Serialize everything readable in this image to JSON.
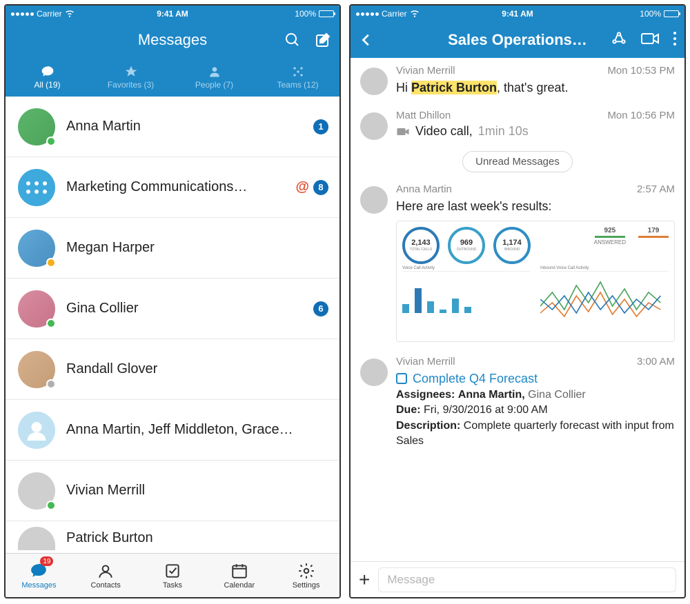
{
  "status": {
    "carrier": "Carrier",
    "time": "9:41 AM",
    "battery": "100%"
  },
  "left": {
    "title": "Messages",
    "tabs": [
      {
        "label": "All (19)"
      },
      {
        "label": "Favorites (3)"
      },
      {
        "label": "People (7)"
      },
      {
        "label": "Teams (12)"
      }
    ],
    "rows": [
      {
        "name": "Anna Martin",
        "badge": "1"
      },
      {
        "name": "Marketing Communications…",
        "mention": "@",
        "badge": "8"
      },
      {
        "name": "Megan Harper"
      },
      {
        "name": "Gina Collier",
        "badge": "6"
      },
      {
        "name": "Randall Glover"
      },
      {
        "name": "Anna Martin, Jeff Middleton, Grace…"
      },
      {
        "name": "Vivian Merrill"
      },
      {
        "name": "Patrick Burton"
      }
    ],
    "nav": [
      {
        "label": "Messages",
        "badge": "19"
      },
      {
        "label": "Contacts"
      },
      {
        "label": "Tasks"
      },
      {
        "label": "Calendar"
      },
      {
        "label": "Settings"
      }
    ]
  },
  "right": {
    "title": "Sales Operations…",
    "messages": {
      "m1": {
        "sender": "Vivian Merrill",
        "time": "Mon 10:53 PM",
        "pre": "Hi ",
        "mention": "Patrick Burton",
        "post": ", that's great."
      },
      "m2": {
        "sender": "Matt Dhillon",
        "time": "Mon 10:56 PM",
        "video_label": "Video call,",
        "duration": "1min 10s"
      },
      "unread": "Unread Messages",
      "m3": {
        "sender": "Anna Martin",
        "time": "2:57 AM",
        "text": "Here are last week's results:"
      },
      "m4": {
        "sender": "Vivian Merrill",
        "time": "3:00 AM",
        "task_title": "Complete Q4 Forecast",
        "assignees_label": "Assignees:",
        "assignees_primary": "Anna Martin,",
        "assignees_secondary": "Gina Collier",
        "due_label": "Due:",
        "due_value": "Fri, 9/30/2016 at 9:00 AM",
        "desc_label": "Description:",
        "desc_value": "Complete quarterly forecast with input from Sales"
      }
    },
    "compose_placeholder": "Message"
  },
  "chart_data": {
    "type": "dashboard",
    "gauges": [
      {
        "value": "2,143",
        "label": "TOTAL CALLS"
      },
      {
        "value": "969",
        "label": "OUTBOUND"
      },
      {
        "value": "1,174",
        "label": "INBOUND"
      }
    ],
    "side_metrics": [
      {
        "value": "925",
        "label": "ANSWERED"
      },
      {
        "value": "179",
        "label": ""
      }
    ],
    "left_chart": {
      "title": "Voice Call Activity",
      "type": "bar",
      "bars": [
        30,
        85,
        40,
        10,
        50,
        20
      ]
    },
    "right_chart": {
      "title": "Inbound Voice Call Activity",
      "type": "line"
    }
  }
}
